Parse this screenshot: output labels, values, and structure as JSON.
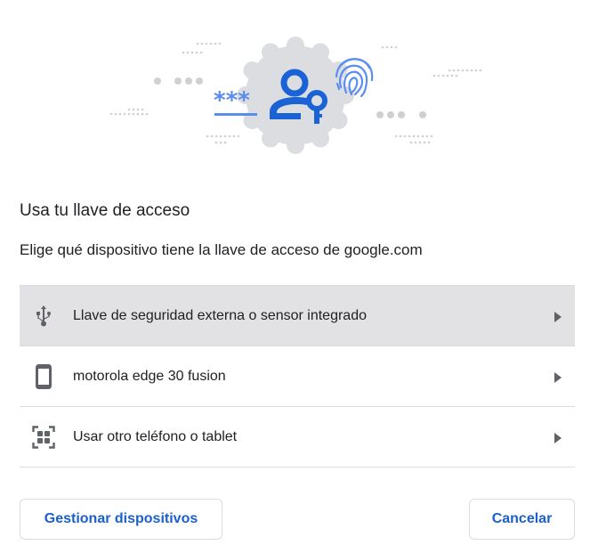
{
  "dialog": {
    "title": "Usa tu llave de acceso",
    "subtitle": "Elige qué dispositivo tiene la llave de acceso de google.com"
  },
  "devices": [
    {
      "label": "Llave de seguridad externa o sensor integrado",
      "icon": "usb-icon",
      "selected": true
    },
    {
      "label": "motorola edge 30 fusion",
      "icon": "phone-icon",
      "selected": false
    },
    {
      "label": "Usar otro teléfono o tablet",
      "icon": "qr-code-icon",
      "selected": false
    }
  ],
  "buttons": {
    "manage_label": "Gestionar dispositivos",
    "cancel_label": "Cancelar"
  },
  "illustration": {
    "password_mask": "***",
    "icons": [
      "user-key-icon",
      "fingerprint-icon"
    ]
  },
  "colors": {
    "accent": "#1a5fd0",
    "illustration_blue": "#1a63d6",
    "illustration_light_blue": "#5b8def",
    "badge_gray": "#dcdde0",
    "dot_gray": "#c9cacd",
    "selected_row": "#e2e2e4",
    "divider": "#dadce0"
  }
}
